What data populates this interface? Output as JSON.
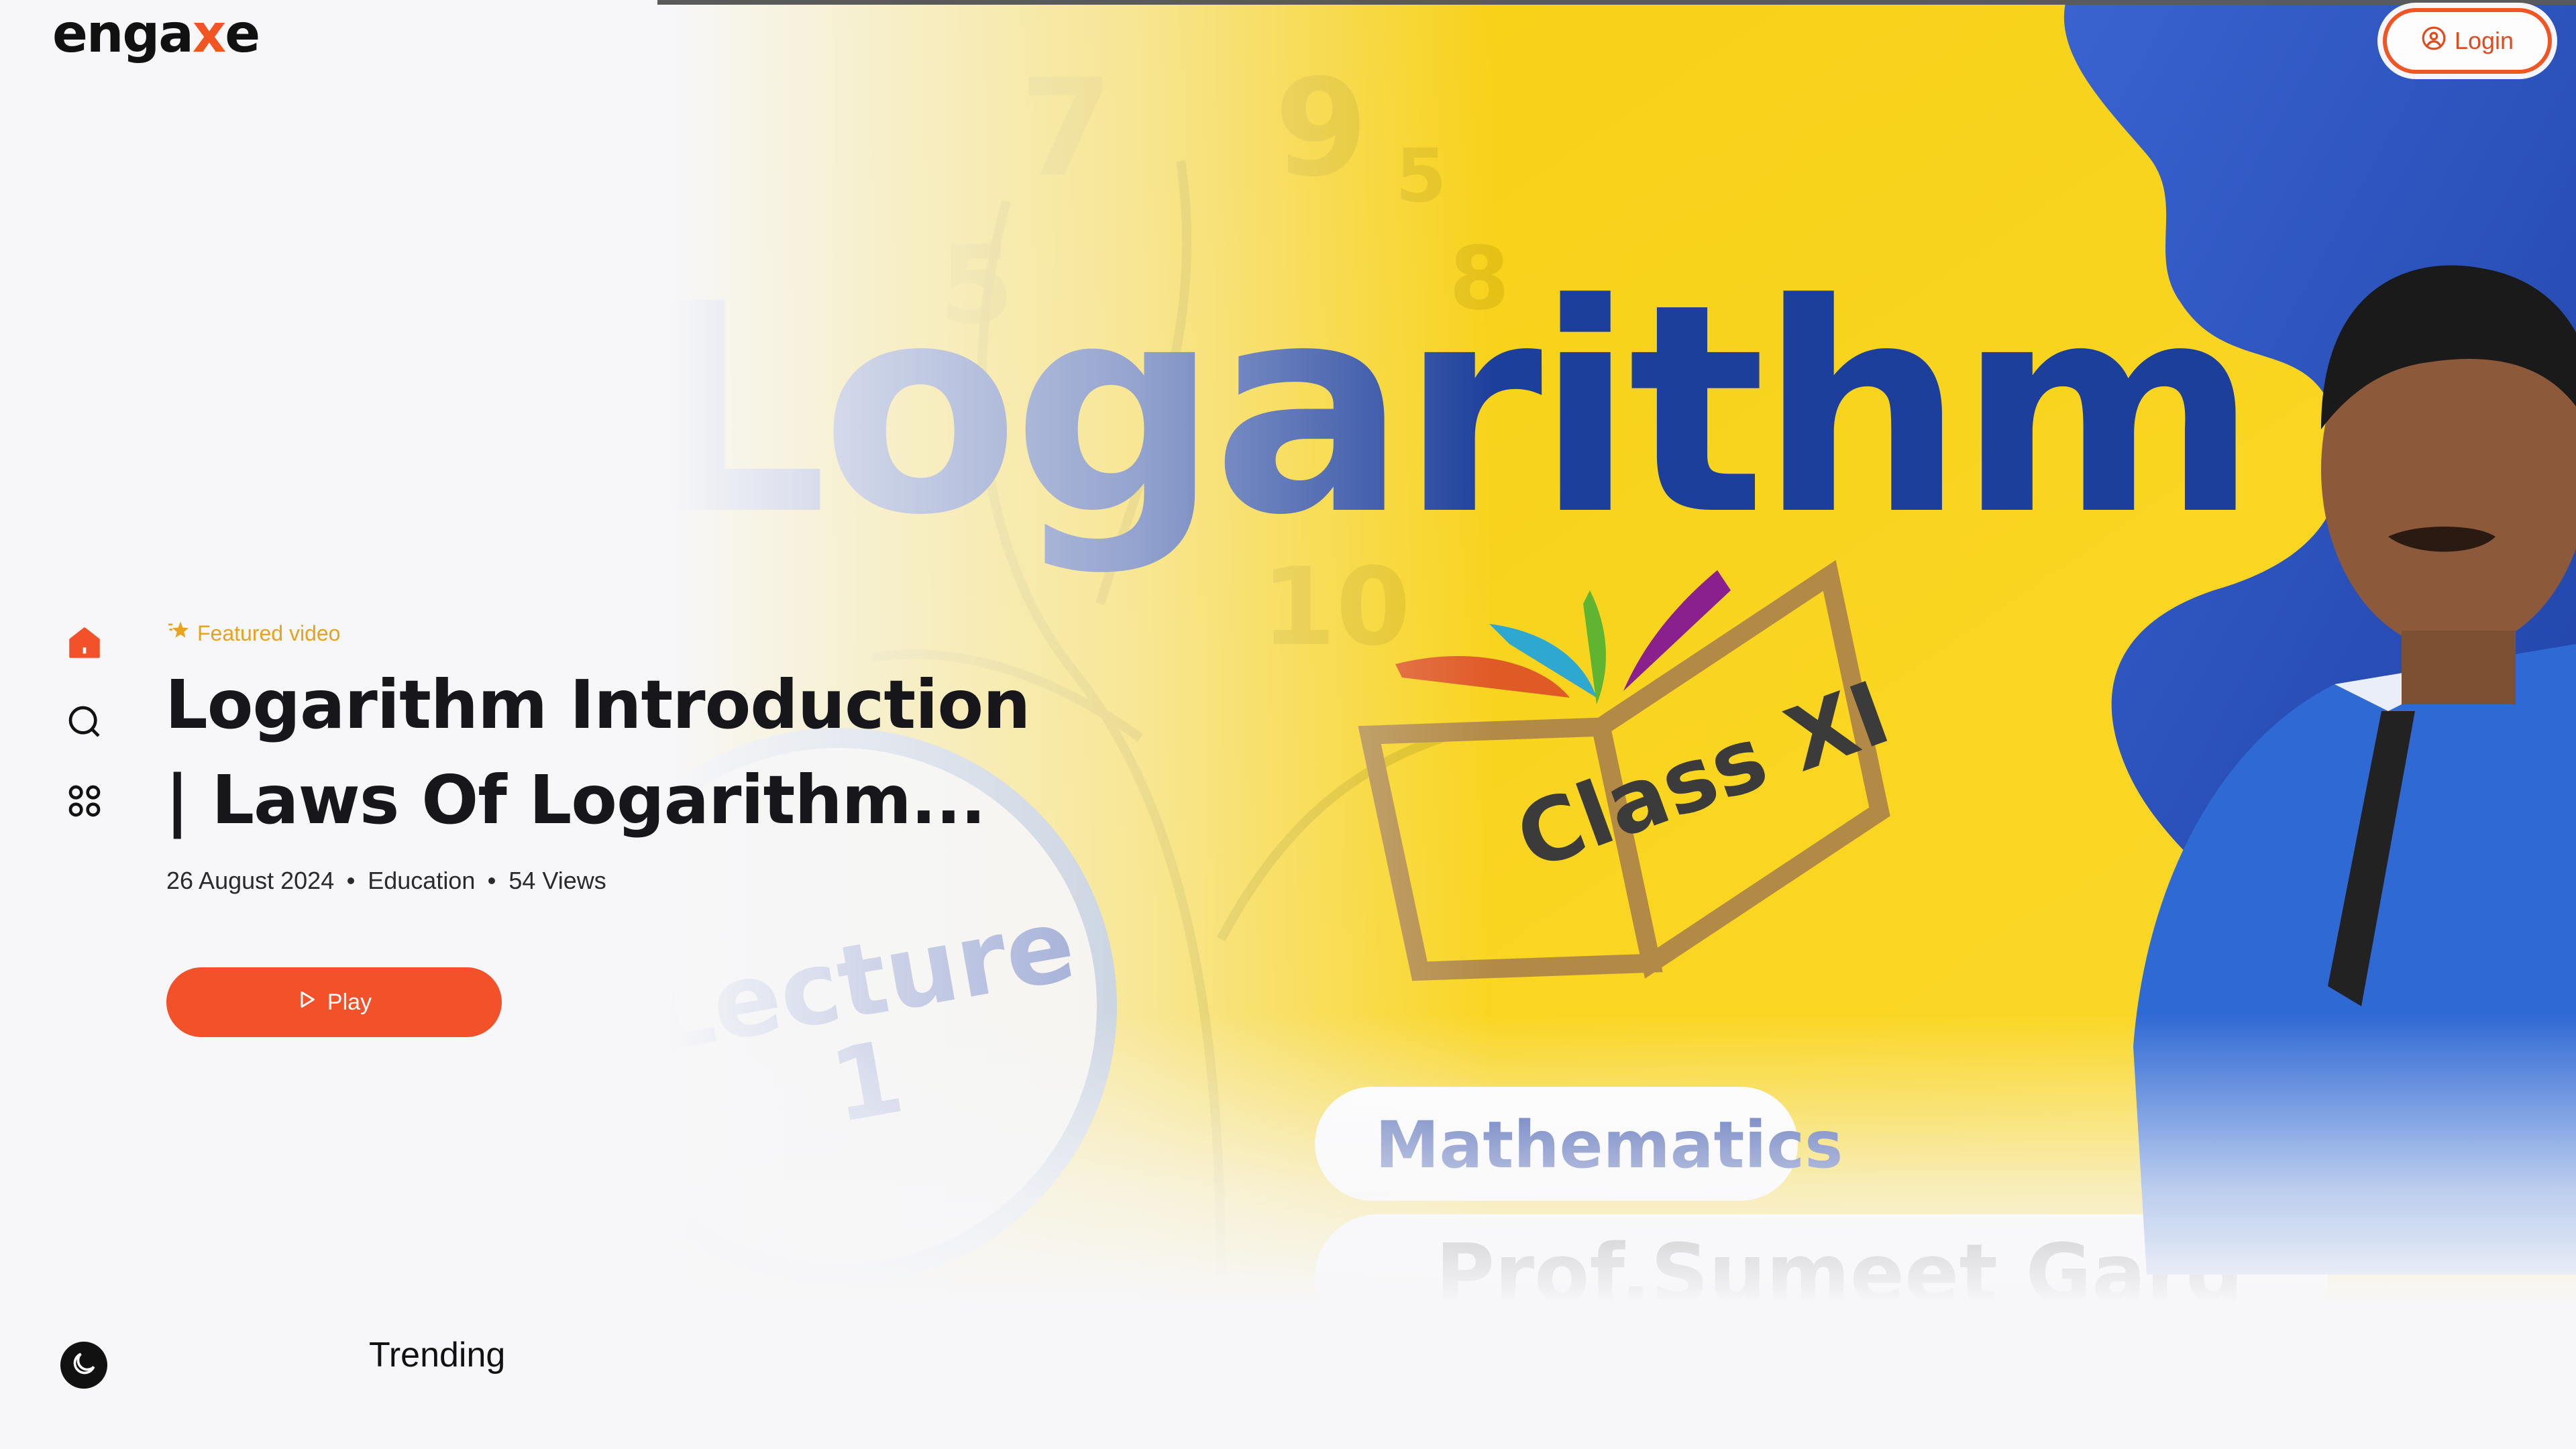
{
  "header": {
    "logo_prefix": "enga",
    "logo_x": "x",
    "logo_suffix": "e",
    "login_label": "Login"
  },
  "sidebar": {
    "items": [
      {
        "name": "home",
        "icon": "home-icon",
        "active": true
      },
      {
        "name": "search",
        "icon": "search-icon",
        "active": false
      },
      {
        "name": "categories",
        "icon": "grid-icon",
        "active": false
      }
    ],
    "theme_toggle_icon": "moon-icon"
  },
  "hero": {
    "badge": "Featured video",
    "title": "Logarithm Introduction | Laws Of Logarithm...",
    "date": "26 August 2024",
    "category": "Education",
    "views": "54 Views",
    "play_label": "Play",
    "thumbnail": {
      "headline": "Logarithm",
      "class_label": "Class XI",
      "lecture_label": "Lecture",
      "lecture_number": "1",
      "subject": "Mathematics",
      "presenter": "Prof.Sumeet Garg"
    }
  },
  "sections": {
    "trending_title": "Trending"
  },
  "colors": {
    "accent": "#f2512a",
    "featured": "#e8a21b",
    "thumb_yellow": "#fbd41a",
    "thumb_blue": "#1d3f9c"
  }
}
